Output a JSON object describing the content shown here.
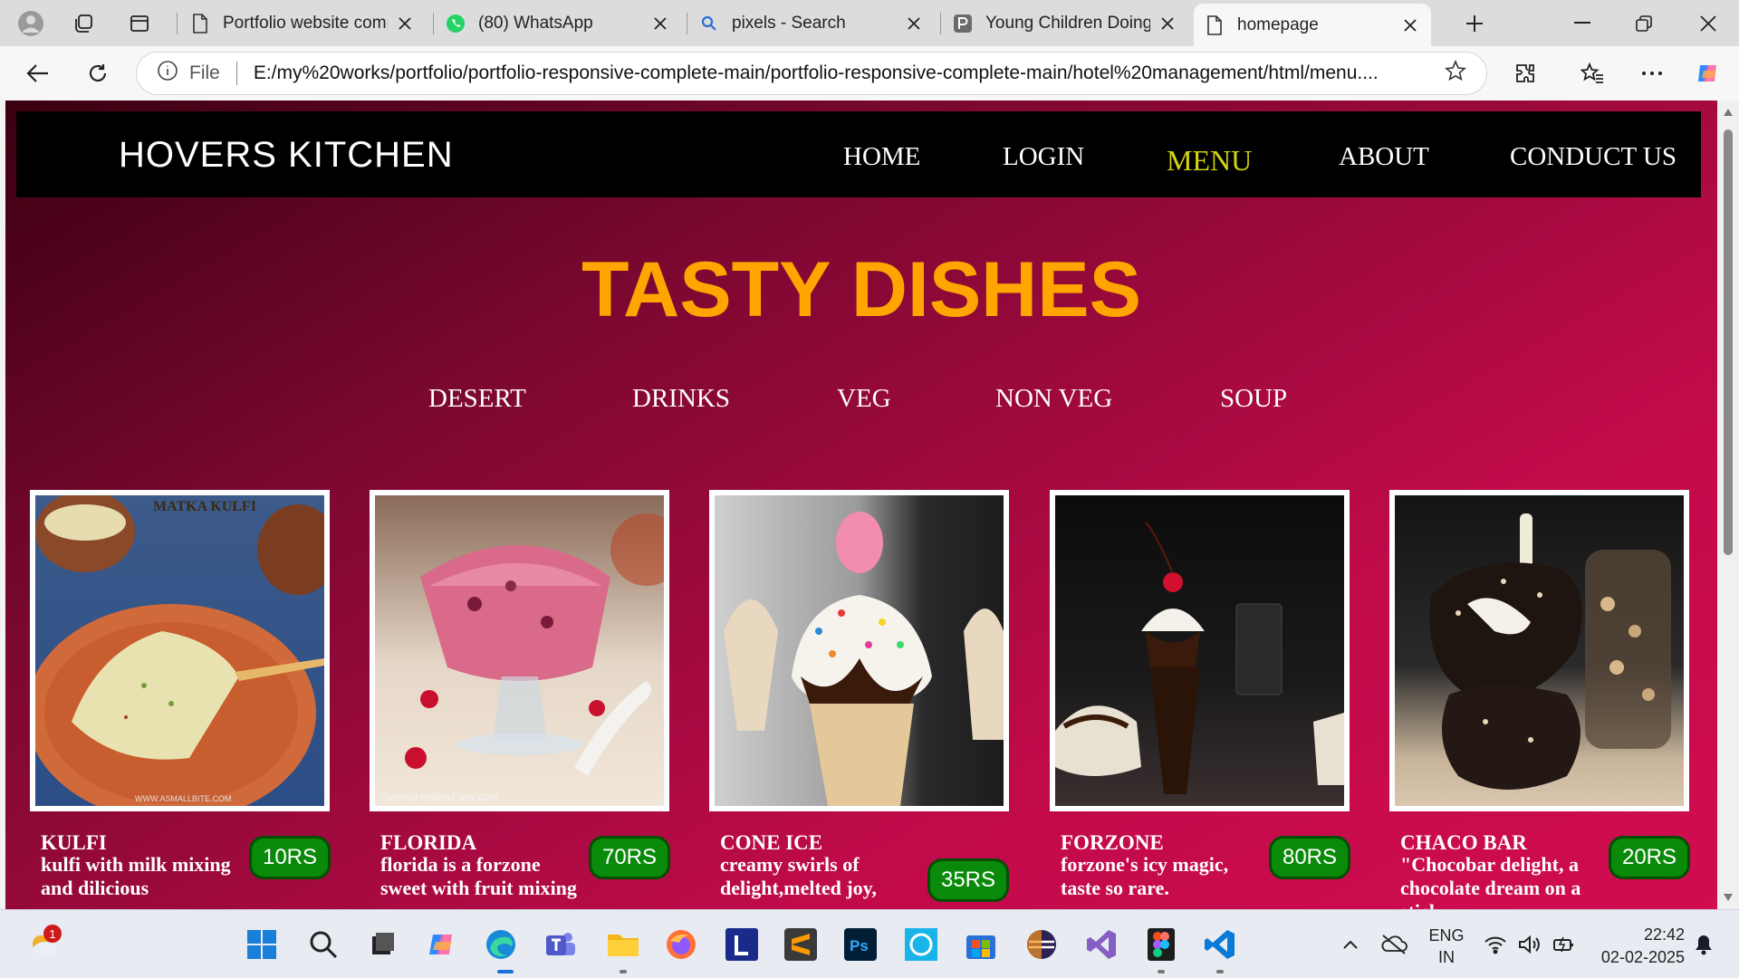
{
  "browser": {
    "tabs": [
      {
        "title": "Portfolio website compl",
        "icon": "page-icon"
      },
      {
        "title": "(80) WhatsApp",
        "icon": "whatsapp-icon"
      },
      {
        "title": "pixels - Search",
        "icon": "search-icon"
      },
      {
        "title": "Young Children Doing F",
        "icon": "pexels-icon"
      },
      {
        "title": "homepage",
        "icon": "page-icon",
        "active": true
      }
    ],
    "address": {
      "scheme_label": "File",
      "url": "E:/my%20works/portfolio/portfolio-responsive-complete-main/portfolio-responsive-complete-main/hotel%20management/html/menu...."
    }
  },
  "site": {
    "logo": "HOVERS KITCHEN",
    "nav": [
      "HOME",
      "LOGIN",
      "MENU",
      "ABOUT",
      "CONDUCT US"
    ],
    "current_nav": "MENU",
    "heading": "TASTY DISHES",
    "categories": [
      "DESERT",
      "DRINKS",
      "VEG",
      "NON VEG",
      "SOUP"
    ],
    "dishes": [
      {
        "name": "KULFI",
        "desc": "kulfi with milk mixing and dilicious",
        "price": "10RS",
        "photo_text": "MATKA KULFI",
        "photo_footer": "WWW.ASMALLBITE.COM"
      },
      {
        "name": "FLORIDA",
        "desc": "florida is a forzone sweet with fruit mixing",
        "price": "70RS",
        "photo_text": "",
        "photo_footer": "YummyHealthyEasy.com"
      },
      {
        "name": "CONE ICE",
        "desc": "creamy swirls of delight,melted joy,",
        "price": "35RS",
        "photo_text": "",
        "photo_footer": ""
      },
      {
        "name": "FORZONE",
        "desc": "forzone's icy magic, taste so rare.",
        "price": "80RS",
        "photo_text": "",
        "photo_footer": ""
      },
      {
        "name": "CHACO BAR",
        "desc": "\"Chocobar delight, a chocolate dream on a stick,",
        "price": "20RS",
        "photo_text": "",
        "photo_footer": ""
      }
    ]
  },
  "taskbar": {
    "notification_count": "1",
    "lang_primary": "ENG",
    "lang_secondary": "IN",
    "time": "22:42",
    "date": "02-02-2025"
  },
  "colors": {
    "accent_heading": "#ffa500",
    "nav_current": "#d4d411",
    "price_badge": "#0a8a0a"
  }
}
